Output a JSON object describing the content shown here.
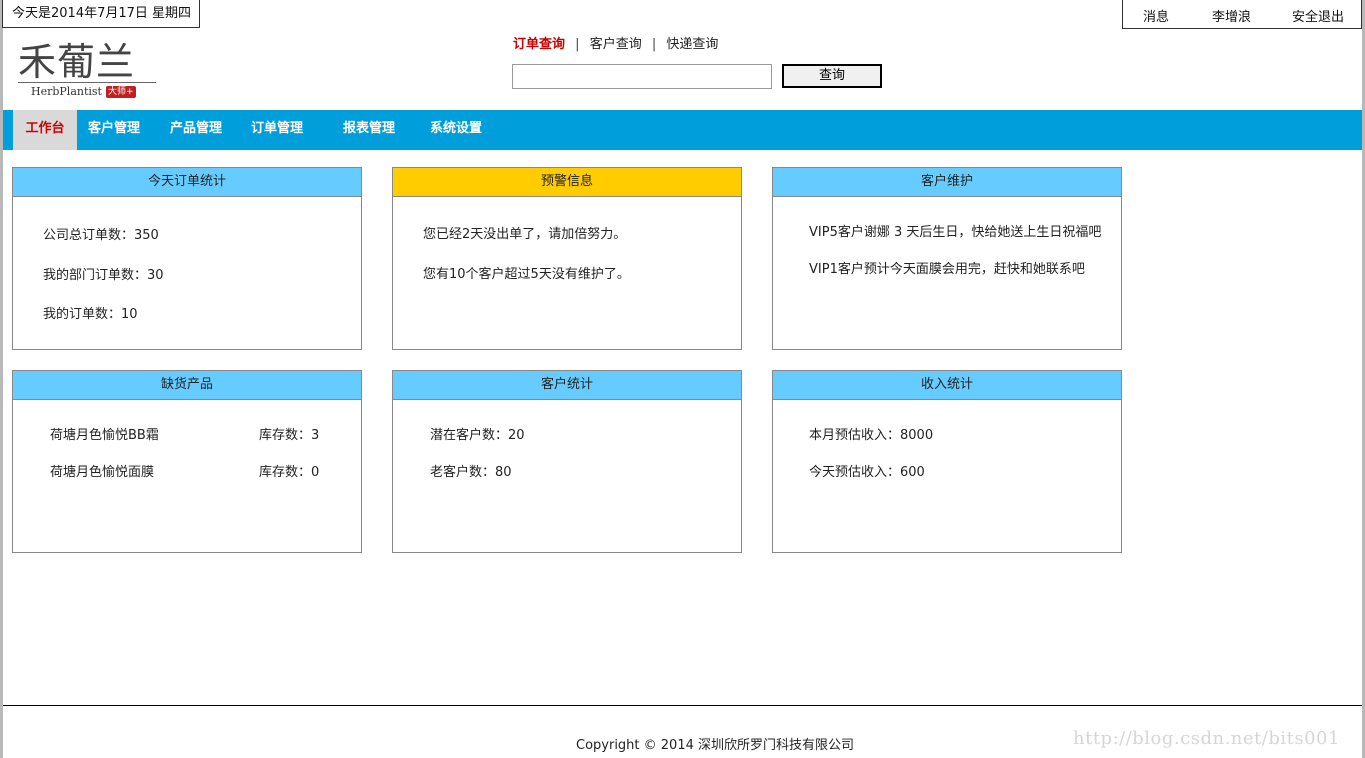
{
  "header": {
    "date_text": "今天是2014年7月17日 星期四",
    "messages_label": "消息",
    "user_name": "李增浪",
    "logout_label": "安全退出"
  },
  "logo": {
    "text_cn": "禾葡兰",
    "text_en": "HerbPlantist",
    "badge": "大师+"
  },
  "search": {
    "tabs": [
      "订单查询",
      "客户查询",
      "快递查询"
    ],
    "separator": "|",
    "input_value": "",
    "button_label": "查询"
  },
  "nav": {
    "items": [
      "工作台",
      "客户管理",
      "产品管理",
      "订单管理",
      "报表管理",
      "系统设置"
    ],
    "active_index": 0
  },
  "panels": {
    "today_orders": {
      "title": "今天订单统计",
      "lines": [
        "公司总订单数：350",
        "我的部门订单数：30",
        "我的订单数：10"
      ]
    },
    "alerts": {
      "title": "预警信息",
      "lines": [
        "您已经2天没出单了，请加倍努力。",
        "您有10个客户超过5天没有维护了。"
      ]
    },
    "customer_care": {
      "title": "客户维护",
      "lines": [
        "VIP5客户谢娜 3 天后生日，快给她送上生日祝福吧",
        "VIP1客户预计今天面膜会用完，赶快和她联系吧"
      ]
    },
    "out_of_stock": {
      "title": "缺货产品",
      "items": [
        {
          "name": "荷塘月色愉悦BB霜",
          "stock": "库存数：3"
        },
        {
          "name": "荷塘月色愉悦面膜",
          "stock": "库存数：0"
        }
      ]
    },
    "customer_stats": {
      "title": "客户统计",
      "lines": [
        "潜在客户数：20",
        "老客户数：80"
      ]
    },
    "income_stats": {
      "title": "收入统计",
      "lines": [
        "本月预估收入：8000",
        "今天预估收入：600"
      ]
    }
  },
  "footer": {
    "copyright": "Copyright © 2014  深圳欣所罗门科技有限公司",
    "watermark": "http://blog.csdn.net/bits001"
  },
  "colors": {
    "nav_bg": "#009fdb",
    "panel_header": "#66ccff",
    "warning_header": "#ffcc00",
    "active_red": "#cc0000"
  }
}
